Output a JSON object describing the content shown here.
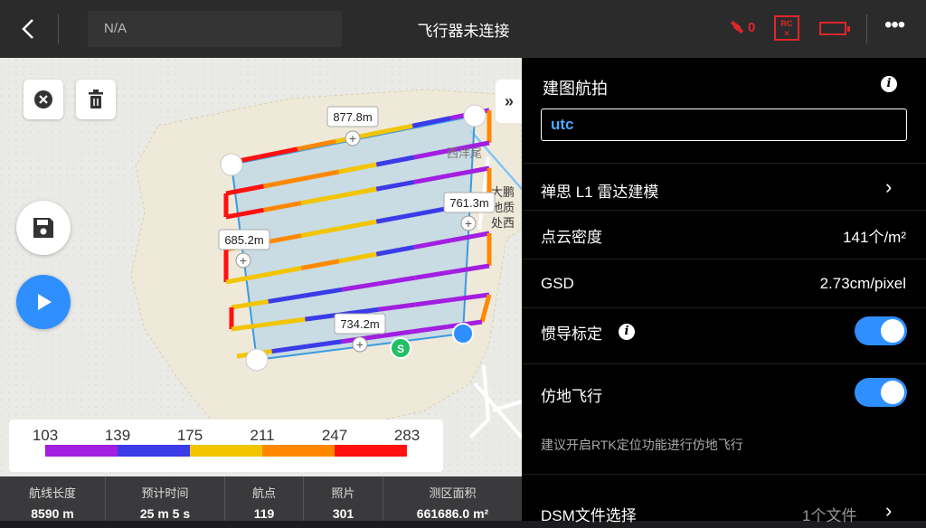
{
  "header": {
    "na_label": "N/A",
    "title": "飞行器未连接",
    "satellite_count": "0",
    "rc_label": "RC"
  },
  "legend": {
    "labels": [
      "103",
      "139",
      "175",
      "211",
      "247",
      "283"
    ],
    "colors": [
      "#a21ee0",
      "#3b3be8",
      "#f2c500",
      "#ff8800",
      "#ff1010"
    ]
  },
  "map": {
    "label_top": "877.8m",
    "label_right": "761.3m",
    "label_left": "685.2m",
    "label_bottom": "734.2m",
    "start_marker": "S",
    "place_1": "西洋尾",
    "place_2a": "大鹏",
    "place_2b": "地质",
    "place_2c": "处西"
  },
  "stats": [
    {
      "label": "航线长度",
      "value": "8590 m"
    },
    {
      "label": "预计时间",
      "value": "25 m 5 s"
    },
    {
      "label": "航点",
      "value": "119"
    },
    {
      "label": "照片",
      "value": "301"
    },
    {
      "label": "测区面积",
      "value": "661686.0 m²"
    }
  ],
  "panel": {
    "title": "建图航拍",
    "name_value": "utc",
    "payload": "禅思 L1 雷达建模",
    "density_label": "点云密度",
    "density_value": "141个/m²",
    "gsd_label": "GSD",
    "gsd_value": "2.73cm/pixel",
    "imu_label": "惯导标定",
    "terrain_label": "仿地飞行",
    "hint": "建议开启RTK定位功能进行仿地飞行",
    "dsm_label": "DSM文件选择",
    "dsm_value": "1个文件"
  }
}
